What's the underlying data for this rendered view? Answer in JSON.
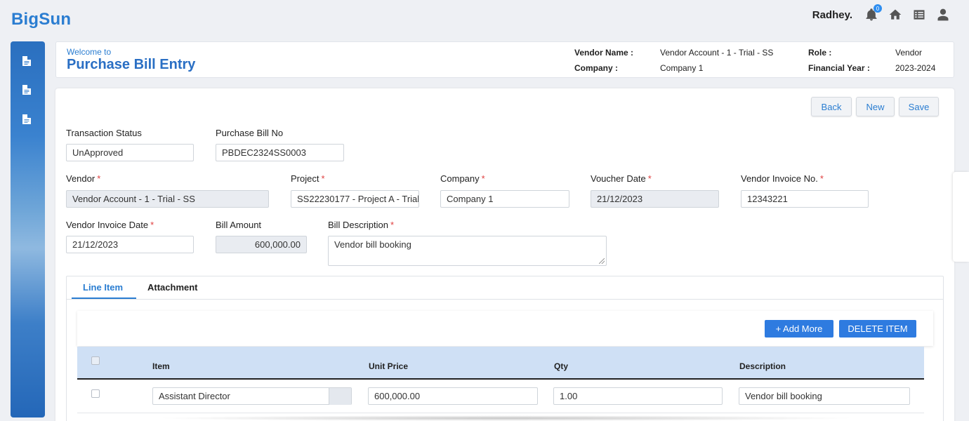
{
  "app": {
    "brand": "BigSun"
  },
  "topbar": {
    "username": "Radhey.",
    "notification_count": "0"
  },
  "welcome": {
    "label": "Welcome to",
    "title": "Purchase Bill Entry",
    "vendor_name_label": "Vendor Name :",
    "vendor_name_value": "Vendor Account - 1 - Trial - SS",
    "company_label": "Company :",
    "company_value": "Company 1",
    "role_label": "Role :",
    "role_value": "Vendor",
    "fy_label": "Financial Year :",
    "fy_value": "2023-2024"
  },
  "actions": {
    "back": "Back",
    "new": "New",
    "save": "Save"
  },
  "form": {
    "transaction_status": {
      "label": "Transaction Status",
      "value": "UnApproved"
    },
    "purchase_bill_no": {
      "label": "Purchase Bill No",
      "value": "PBDEC2324SS0003"
    },
    "vendor": {
      "label": "Vendor",
      "value": "Vendor Account - 1 - Trial - SS"
    },
    "project": {
      "label": "Project",
      "value": "SS22230177 - Project A - Trial"
    },
    "company": {
      "label": "Company",
      "value": "Company 1"
    },
    "voucher_date": {
      "label": "Voucher Date",
      "value": "21/12/2023"
    },
    "vendor_invoice_no": {
      "label": "Vendor Invoice No.",
      "value": "12343221"
    },
    "vendor_invoice_date": {
      "label": "Vendor Invoice Date",
      "value": "21/12/2023"
    },
    "bill_amount": {
      "label": "Bill Amount",
      "value": "600,000.00"
    },
    "bill_description": {
      "label": "Bill Description",
      "value": "Vendor bill booking"
    },
    "required_mark": "*"
  },
  "tabs": [
    {
      "label": "Line Item"
    },
    {
      "label": "Attachment"
    }
  ],
  "grid": {
    "add_more": "+ Add More",
    "delete_item": "DELETE ITEM",
    "columns": [
      "Item",
      "Unit Price",
      "Qty",
      "Description"
    ],
    "rows": [
      {
        "item": "Assistant Director",
        "unit_price": "600,000.00",
        "qty": "1.00",
        "description": "Vendor bill booking"
      }
    ]
  },
  "colors": {
    "accent": "#2a7dd1",
    "primary_button": "#2e7be0",
    "grid_header": "#cfe0f5",
    "required": "#e04040"
  }
}
